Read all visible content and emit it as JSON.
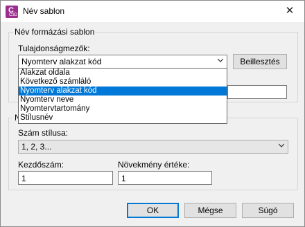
{
  "window": {
    "title": "Név sablon",
    "app_icon_letter": "C",
    "app_icon_sub": "C3D"
  },
  "name_format": {
    "group_label": "Név formázási sablon",
    "property_fields_label": "Tulajdonságmezők:",
    "selected_field": "Nyomterv alakzat kód",
    "insert_button": "Beillesztés",
    "dropdown_items": [
      "Alakzat oldala",
      "Következő számláló",
      "Nyomterv alakzat kód",
      "Nyomterv neve",
      "Nyomtervtartomány",
      "Stílusnév"
    ],
    "selected_index": 2,
    "template_value": ""
  },
  "numbering": {
    "group_label_fragment": "N",
    "number_style_label": "Szám stílusa:",
    "number_style_value": "1, 2, 3...",
    "start_label": "Kezdőszám:",
    "start_value": "1",
    "increment_label": "Növekmény értéke:",
    "increment_value": "1"
  },
  "buttons": {
    "ok": "OK",
    "cancel": "Mégse",
    "help": "Súgó"
  },
  "close_glyph": "✕"
}
